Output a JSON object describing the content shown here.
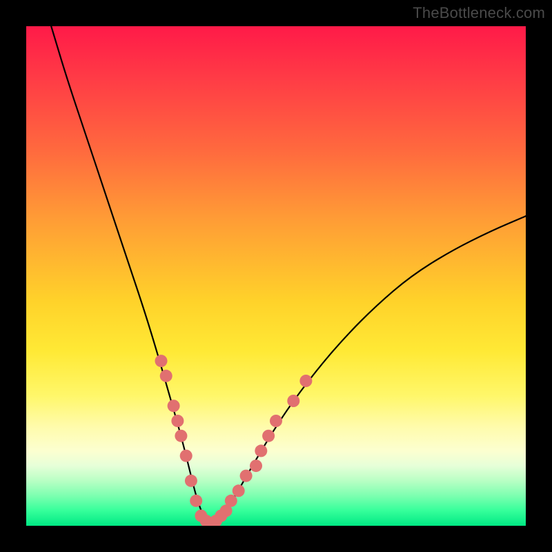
{
  "watermark": "TheBottleneck.com",
  "chart_data": {
    "type": "line",
    "title": "",
    "xlabel": "",
    "ylabel": "",
    "xlim": [
      0,
      100
    ],
    "ylim": [
      0,
      100
    ],
    "grid": false,
    "series": [
      {
        "name": "bottleneck-curve",
        "x": [
          5,
          8,
          12,
          16,
          20,
          24,
          27,
          29,
          31,
          33,
          34,
          35,
          36,
          37,
          38,
          40,
          43,
          47,
          52,
          58,
          64,
          70,
          77,
          85,
          93,
          100
        ],
        "y": [
          100,
          90,
          78,
          66,
          54,
          42,
          32,
          25,
          18,
          10,
          6,
          3,
          1,
          0,
          1,
          3,
          8,
          15,
          23,
          31,
          38,
          44,
          50,
          55,
          59,
          62
        ],
        "color": "#000000",
        "width": 2.2
      }
    ],
    "markers": {
      "name": "highlight-dots",
      "color": "#e17070",
      "radius": 9,
      "points": [
        {
          "x": 27.0,
          "y": 33
        },
        {
          "x": 28.0,
          "y": 30
        },
        {
          "x": 29.5,
          "y": 24
        },
        {
          "x": 30.3,
          "y": 21
        },
        {
          "x": 31.0,
          "y": 18
        },
        {
          "x": 32.0,
          "y": 14
        },
        {
          "x": 33.0,
          "y": 9
        },
        {
          "x": 34.0,
          "y": 5
        },
        {
          "x": 35.0,
          "y": 2
        },
        {
          "x": 36.0,
          "y": 1
        },
        {
          "x": 37.0,
          "y": 0
        },
        {
          "x": 38.0,
          "y": 1
        },
        {
          "x": 39.0,
          "y": 2
        },
        {
          "x": 40.0,
          "y": 3
        },
        {
          "x": 41.0,
          "y": 5
        },
        {
          "x": 42.5,
          "y": 7
        },
        {
          "x": 44.0,
          "y": 10
        },
        {
          "x": 46.0,
          "y": 12
        },
        {
          "x": 47.0,
          "y": 15
        },
        {
          "x": 48.5,
          "y": 18
        },
        {
          "x": 50.0,
          "y": 21
        },
        {
          "x": 53.5,
          "y": 25
        },
        {
          "x": 56.0,
          "y": 29
        }
      ]
    }
  }
}
